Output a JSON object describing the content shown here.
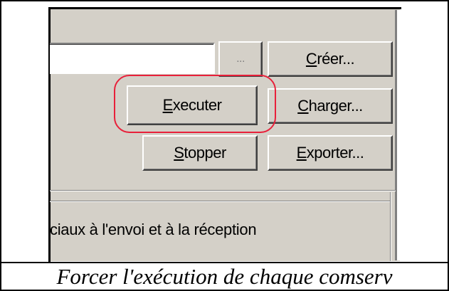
{
  "dialog": {
    "path_field_value": "",
    "buttons": {
      "browse_label": "...",
      "creer_label_mnemonic": "C",
      "creer_label_rest": "réer...",
      "executer_label_mnemonic": "E",
      "executer_label_rest": "xecuter",
      "charger_label_mnemonic": "C",
      "charger_label_rest": "harger...",
      "stopper_label_mnemonic": "S",
      "stopper_label_rest": "topper",
      "exporter_label_mnemonic": "E",
      "exporter_label_rest": "xporter..."
    },
    "checkbox_text": "ciaux à l'envoi et à la réception"
  },
  "caption": "Forcer l'exécution de chaque comserv",
  "colors": {
    "face": "#d4d0c8",
    "highlight_ring": "#e8203a"
  }
}
